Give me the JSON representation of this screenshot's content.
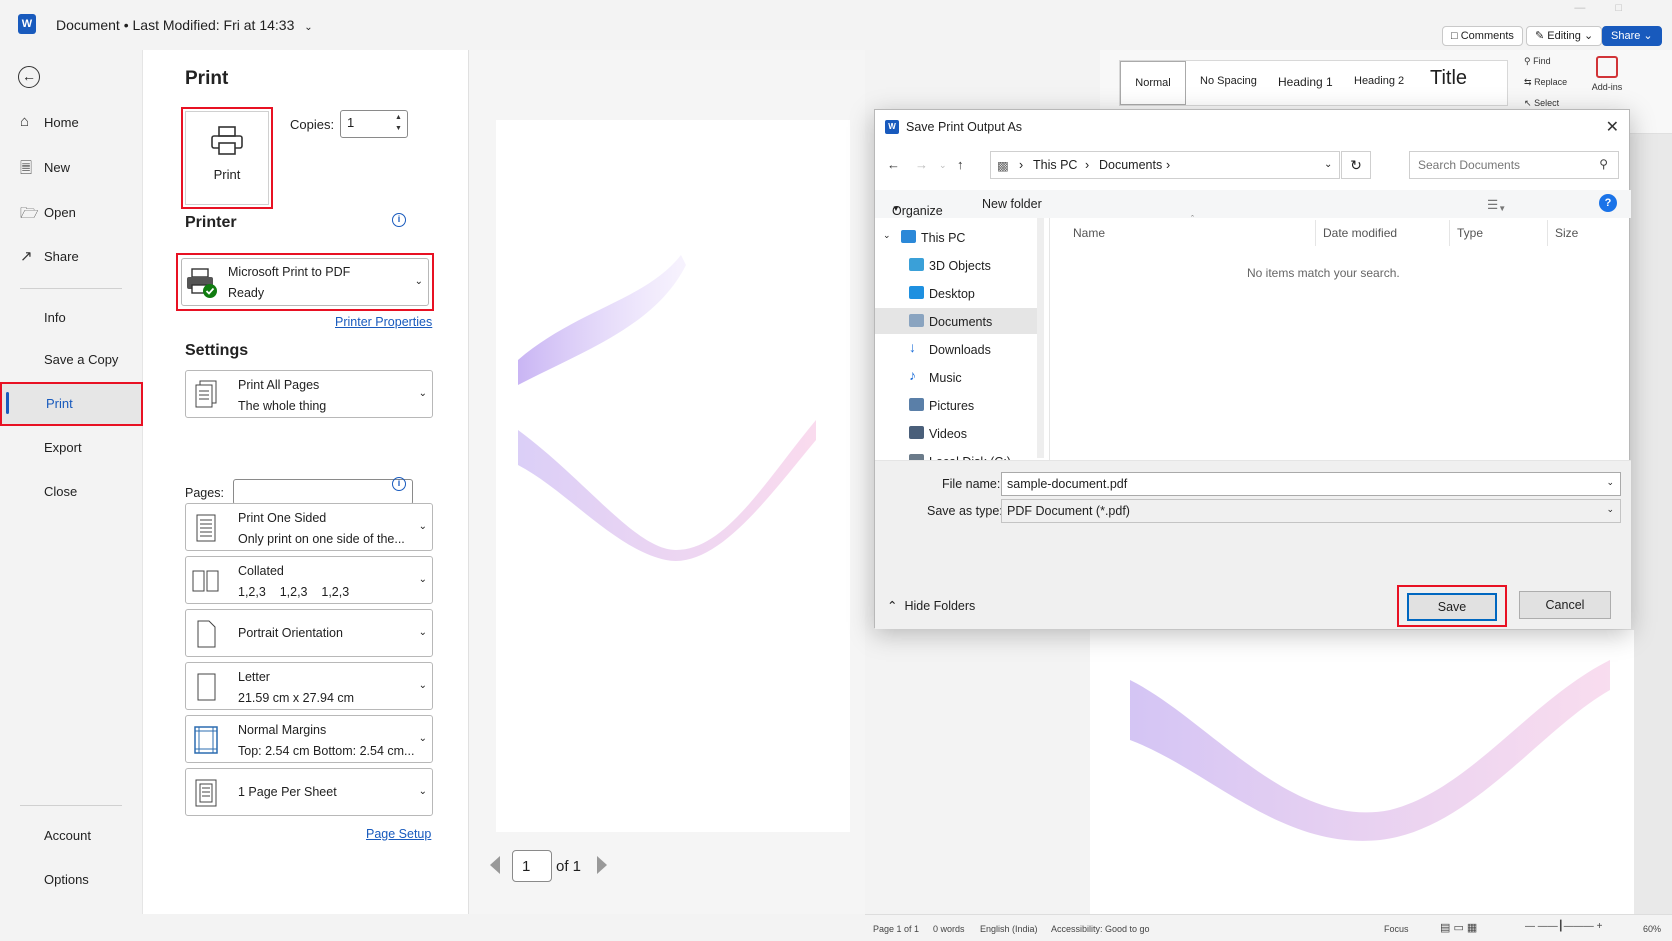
{
  "titlebar": {
    "doc_title": "Document",
    "separator": "•",
    "last_modified": "Last Modified: Fri at 14:33",
    "logo_letter": "W",
    "comments": "Comments",
    "editing": "Editing",
    "share": "Share"
  },
  "ribbon": {
    "styles": [
      "Normal",
      "No Spacing",
      "Heading 1",
      "Heading 2",
      "Title"
    ],
    "find": "Find",
    "replace": "Replace",
    "select": "Select",
    "addins": "Add-ins"
  },
  "nav": {
    "items": [
      {
        "label": "Home",
        "icon": "home-icon"
      },
      {
        "label": "New",
        "icon": "new-doc-icon"
      },
      {
        "label": "Open",
        "icon": "folder-open-icon"
      },
      {
        "label": "Share",
        "icon": "share-icon"
      },
      {
        "label": "Info"
      },
      {
        "label": "Save a Copy"
      },
      {
        "label": "Print"
      },
      {
        "label": "Export"
      },
      {
        "label": "Close"
      },
      {
        "label": "Account"
      },
      {
        "label": "Options"
      }
    ]
  },
  "print": {
    "heading": "Print",
    "button_label": "Print",
    "copies_label": "Copies:",
    "copies_value": "1",
    "printer_heading": "Printer",
    "printer_name": "Microsoft Print to PDF",
    "printer_status": "Ready",
    "printer_properties": "Printer Properties",
    "settings_heading": "Settings",
    "pages_label": "Pages:",
    "pages_value": "",
    "settings": [
      {
        "line1": "Print All Pages",
        "line2": "The whole thing"
      },
      {
        "line1": "Print One Sided",
        "line2": "Only print on one side of the..."
      },
      {
        "line1": "Collated",
        "line2": "1,2,3    1,2,3    1,2,3"
      },
      {
        "line1": "Portrait Orientation",
        "line2": ""
      },
      {
        "line1": "Letter",
        "line2": "21.59 cm x 27.94 cm"
      },
      {
        "line1": "Normal Margins",
        "line2": "Top: 2.54 cm Bottom: 2.54 cm..."
      },
      {
        "line1": "1 Page Per Sheet",
        "line2": ""
      }
    ],
    "page_setup": "Page Setup",
    "current_page": "1",
    "page_of": "of 1"
  },
  "dialog": {
    "title": "Save Print Output As",
    "breadcrumb": [
      "This PC",
      "Documents"
    ],
    "search_placeholder": "Search Documents",
    "organize": "Organize",
    "new_folder": "New folder",
    "tree": [
      {
        "label": "This PC",
        "color": "#2b88d8"
      },
      {
        "label": "3D Objects",
        "color": "#3aa0d8"
      },
      {
        "label": "Desktop",
        "color": "#1e90e0"
      },
      {
        "label": "Documents",
        "color": "#8aa4c0"
      },
      {
        "label": "Downloads",
        "color": "#1e6fd9"
      },
      {
        "label": "Music",
        "color": "#1e6fd9"
      },
      {
        "label": "Pictures",
        "color": "#5a7fa8"
      },
      {
        "label": "Videos",
        "color": "#4a5f7a"
      },
      {
        "label": "Local Disk (C:)",
        "color": "#6b7b8a"
      }
    ],
    "columns": [
      "Name",
      "Date modified",
      "Type",
      "Size"
    ],
    "empty_message": "No items match your search.",
    "file_name_label": "File name:",
    "file_name_value": "sample-document.pdf",
    "save_type_label": "Save as type:",
    "save_type_value": "PDF Document (*.pdf)",
    "hide_folders": "Hide Folders",
    "save": "Save",
    "cancel": "Cancel"
  },
  "statusbar": {
    "page": "Page 1 of 1",
    "words": "0 words",
    "language": "English (India)",
    "accessibility": "Accessibility: Good to go",
    "focus": "Focus",
    "zoom": "60%"
  },
  "colors": {
    "accent": "#185abd",
    "highlight": "#e81123"
  }
}
